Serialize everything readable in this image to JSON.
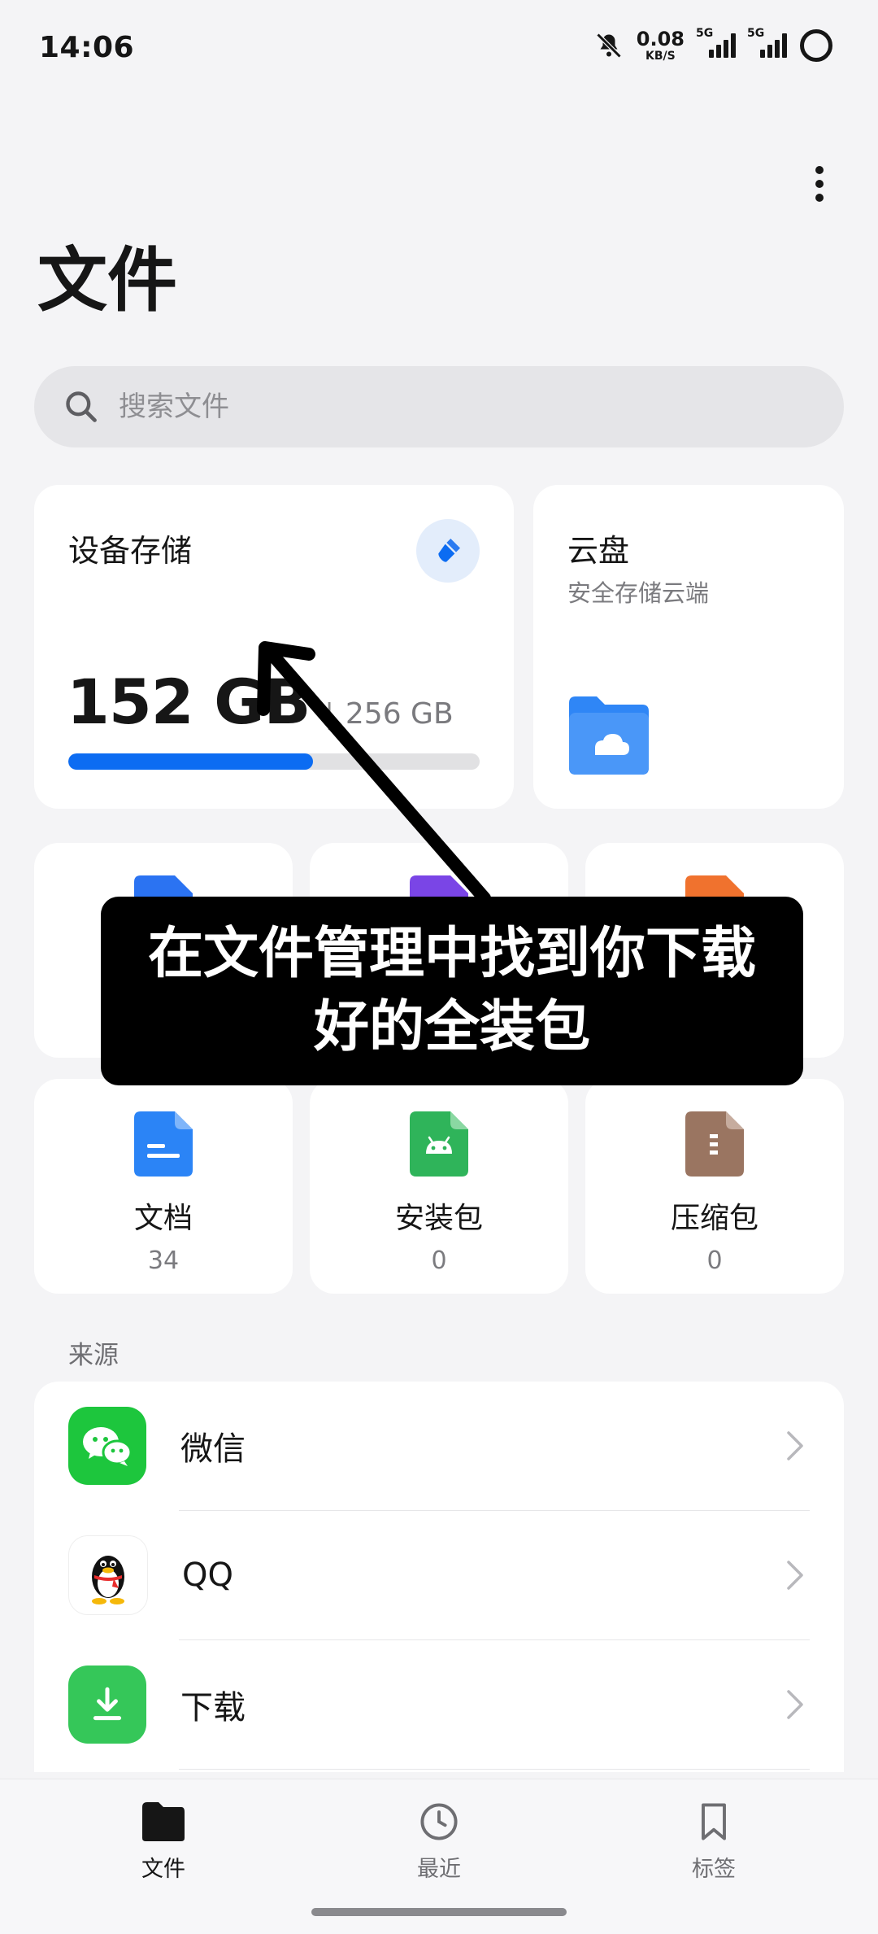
{
  "status_bar": {
    "time": "14:06",
    "net_speed_value": "0.08",
    "net_speed_unit": "KB/S",
    "signal_1_label": "5G",
    "signal_2_label": "5G"
  },
  "header": {
    "title": "文件"
  },
  "search": {
    "placeholder": "搜索文件"
  },
  "storage": {
    "title": "设备存储",
    "used": "152 GB",
    "separator": "|",
    "total": "256 GB",
    "used_fraction": 0.594
  },
  "cloud": {
    "title": "云盘",
    "subtitle": "安全存储云端"
  },
  "categories_row2": [
    {
      "label": "文档",
      "count": "34"
    },
    {
      "label": "安装包",
      "count": "0"
    },
    {
      "label": "压缩包",
      "count": "0"
    }
  ],
  "overlay": {
    "line1": "在文件管理中找到你下载",
    "line2": "好的全装包"
  },
  "sources": {
    "title": "来源",
    "items": [
      {
        "label": "微信"
      },
      {
        "label": "QQ"
      },
      {
        "label": "下载"
      }
    ]
  },
  "nav": {
    "items": [
      {
        "label": "文件"
      },
      {
        "label": "最近"
      },
      {
        "label": "标签"
      }
    ]
  },
  "colors": {
    "accent": "#0C6CF2",
    "wechat": "#1DC63D",
    "download": "#35C759"
  }
}
